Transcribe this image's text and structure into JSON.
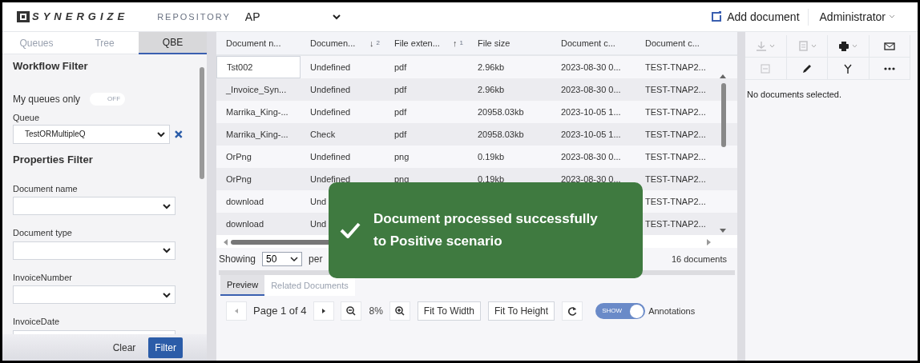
{
  "header": {
    "logo_text": "SYNERGIZE",
    "repository_label": "REPOSITORY",
    "repository_value": "AP",
    "add_document": "Add document",
    "user": "Administrator"
  },
  "left_panel": {
    "tabs": [
      {
        "label": "Queues",
        "selected": false
      },
      {
        "label": "Tree",
        "selected": false
      },
      {
        "label": "QBE",
        "selected": true
      }
    ],
    "workflow_title": "Workflow Filter",
    "my_queues": {
      "label": "My queues only",
      "on": false,
      "state_text": "OFF"
    },
    "queue": {
      "label": "Queue",
      "value": "TestORMultipleQ"
    },
    "properties_title": "Properties Filter",
    "fields": [
      {
        "label": "Document name"
      },
      {
        "label": "Document type"
      },
      {
        "label": "InvoiceNumber"
      },
      {
        "label": "InvoiceDate"
      }
    ],
    "clear": "Clear",
    "filter": "Filter"
  },
  "table": {
    "columns": [
      {
        "label": "Document n..."
      },
      {
        "label": "Documen...",
        "sort_arrow": "↓",
        "sort_order": "2"
      },
      {
        "label": "File exten...",
        "sort_arrow": "↑",
        "sort_order": "1"
      },
      {
        "label": "File size"
      },
      {
        "label": "Document c..."
      },
      {
        "label": "Document c..."
      }
    ],
    "rows": [
      {
        "focused": true,
        "cells": [
          "Tst002",
          "Undefined",
          "pdf",
          "2.96kb",
          "2023-08-30 0...",
          "TEST-TNAP2..."
        ]
      },
      {
        "focused": false,
        "cells": [
          "_Invoice_Syn...",
          "Undefined",
          "pdf",
          "2.96kb",
          "2023-08-30 0...",
          "TEST-TNAP2..."
        ]
      },
      {
        "focused": false,
        "cells": [
          "Marrika_King-...",
          "Undefined",
          "pdf",
          "20958.03kb",
          "2023-10-05 1...",
          "TEST-TNAP2..."
        ]
      },
      {
        "focused": false,
        "cells": [
          "Marrika_King-...",
          "Check",
          "pdf",
          "20958.03kb",
          "2023-10-05 1...",
          "TEST-TNAP2..."
        ]
      },
      {
        "focused": false,
        "cells": [
          "OrPng",
          "Undefined",
          "png",
          "0.19kb",
          "2023-08-30 0...",
          "TEST-TNAP2..."
        ]
      },
      {
        "focused": false,
        "cells": [
          "OrPng",
          "Undefined",
          "png",
          "0.19kb",
          "2023-08-30 0...",
          "TEST-TNAP2..."
        ]
      },
      {
        "focused": false,
        "cells": [
          "download",
          "Und",
          null,
          null,
          null,
          "TEST-TNAP2..."
        ]
      },
      {
        "focused": false,
        "cells": [
          "download",
          "Und",
          null,
          null,
          null,
          "TEST-TNAP2..."
        ]
      }
    ]
  },
  "pagination": {
    "showing": "Showing",
    "per_page_value": "50",
    "per_page": "per",
    "total": "16 documents"
  },
  "preview": {
    "tabs": [
      {
        "label": "Preview",
        "selected": true
      },
      {
        "label": "Related Documents",
        "selected": false
      }
    ],
    "page": "Page 1 of 4",
    "zoom": "8%",
    "fit_width": "Fit To Width",
    "fit_height": "Fit To Height",
    "annotations": {
      "on": true,
      "state_text": "SHOW",
      "label": "Annotations"
    }
  },
  "right_panel": {
    "toolbar": [
      {
        "kind": "download",
        "disabled": true
      },
      {
        "kind": "document",
        "disabled": true
      },
      {
        "kind": "print",
        "disabled": false
      },
      {
        "kind": "mail",
        "disabled": false
      },
      {
        "kind": "stamp",
        "disabled": true
      },
      {
        "kind": "pencil",
        "disabled": false
      },
      {
        "kind": "fork",
        "disabled": false
      },
      {
        "kind": "more",
        "disabled": false
      }
    ],
    "message": "No documents selected."
  },
  "toast": {
    "line1": "Document processed successfully",
    "line2": "to Positive scenario"
  }
}
